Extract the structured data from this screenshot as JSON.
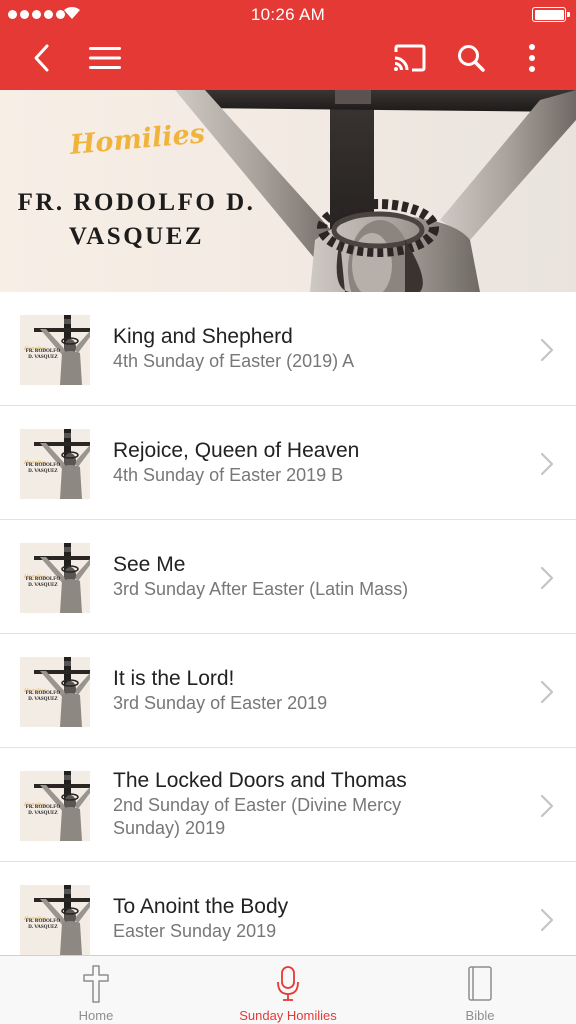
{
  "status_bar": {
    "time": "10:26 AM"
  },
  "hero": {
    "tagline": "Homilies",
    "name_line1": "FR. RODOLFO D.",
    "name_line2": "VASQUEZ"
  },
  "thumbnail": {
    "tagline": "Homilies",
    "name": "FR. RODOLFO D. VASQUEZ"
  },
  "homilies": [
    {
      "title": "King and Shepherd",
      "subtitle": "4th Sunday of Easter (2019) A"
    },
    {
      "title": "Rejoice, Queen of Heaven",
      "subtitle": "4th Sunday of Easter 2019 B"
    },
    {
      "title": "See Me",
      "subtitle": "3rd Sunday After Easter (Latin Mass)"
    },
    {
      "title": "It is the Lord!",
      "subtitle": "3rd Sunday of Easter 2019"
    },
    {
      "title": "The Locked Doors and Thomas",
      "subtitle": "2nd Sunday of Easter (Divine Mercy Sunday) 2019"
    },
    {
      "title": "To Anoint the Body",
      "subtitle": "Easter Sunday 2019"
    }
  ],
  "tabs": [
    {
      "label": "Home",
      "icon": "cross-icon"
    },
    {
      "label": "Sunday Homilies",
      "icon": "microphone-icon",
      "active": true
    },
    {
      "label": "Bible",
      "icon": "book-icon"
    }
  ],
  "colors": {
    "accent": "#e53935",
    "tagline": "#f0b43c"
  }
}
